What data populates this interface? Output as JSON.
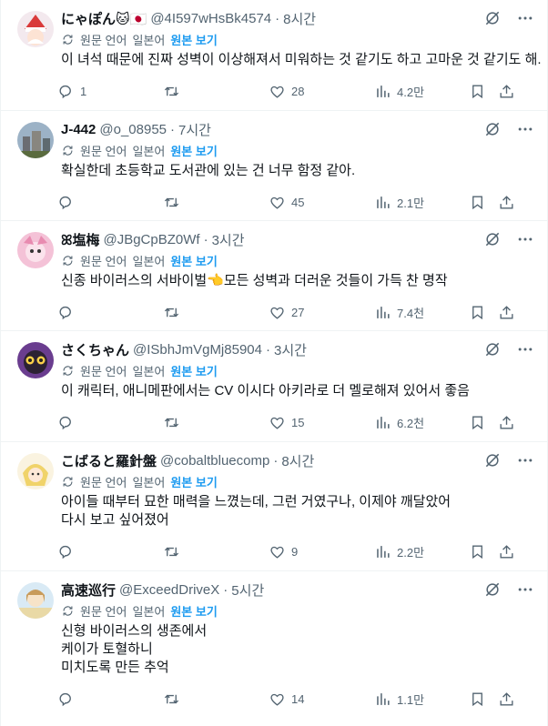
{
  "ui": {
    "original_language": "원문 언어",
    "show_original": "원본 보기"
  },
  "tweets": [
    {
      "name": "にゃぽん🐱🇯🇵",
      "handle": "@4I597wHsBk4574",
      "time": "8시간",
      "lang": "일본어",
      "lines": [
        "이 녀석 때문에 진짜 성벽이 이상해져서 미워하는 것 같기도 하고 고마운 것 같기도 해."
      ],
      "replies": "1",
      "retweets": "",
      "likes": "28",
      "views": "4.2만"
    },
    {
      "name": "J-442",
      "handle": "@o_08955",
      "time": "7시간",
      "lang": "일본어",
      "lines": [
        "확실한데 초등학교 도서관에 있는 건 너무 함정 같아."
      ],
      "replies": "",
      "retweets": "",
      "likes": "45",
      "views": "2.1만"
    },
    {
      "name": "ꕤ塩梅",
      "handle": "@JBgCpBZ0Wf",
      "time": "3시간",
      "lang": "일본어",
      "lines": [
        "신종 바이러스의 서바이벌👈모든 성벽과 더러운 것들이 가득 찬 명작"
      ],
      "replies": "",
      "retweets": "",
      "likes": "27",
      "views": "7.4천"
    },
    {
      "name": "さくちゃん",
      "handle": "@ISbhJmVgMj85904",
      "time": "3시간",
      "lang": "일본어",
      "lines": [
        "이 캐릭터, 애니메판에서는 CV 이시다 아키라로 더 멜로해져 있어서 좋음"
      ],
      "replies": "",
      "retweets": "",
      "likes": "15",
      "views": "6.2천"
    },
    {
      "name": "こばると羅針盤",
      "handle": "@cobaltbluecomp",
      "time": "8시간",
      "lang": "일본어",
      "lines": [
        "아이들 때부터 묘한 매력을 느꼈는데, 그런 거였구나, 이제야 깨달았어",
        "다시 보고 싶어졌어"
      ],
      "replies": "",
      "retweets": "",
      "likes": "9",
      "views": "2.2만"
    },
    {
      "name": "高速巡行",
      "handle": "@ExceedDriveX",
      "time": "5시간",
      "lang": "일본어",
      "lines": [
        "신형 바이러스의 생존에서",
        "케이가 토혈하니",
        "미치도록 만든 추억"
      ],
      "replies": "",
      "retweets": "",
      "likes": "14",
      "views": "1.1만"
    }
  ],
  "icons": {
    "reply": "reply-icon",
    "retweet": "retweet-icon",
    "like": "heart-icon",
    "views": "views-icon",
    "bookmark": "bookmark-icon",
    "share": "share-icon",
    "grok": "grok-icon",
    "more": "more-icon",
    "translate": "translate-icon"
  },
  "colors": {
    "text": "#0f1419",
    "secondary": "#536471",
    "link": "#1d9bf0",
    "divider": "#eff3f4"
  }
}
